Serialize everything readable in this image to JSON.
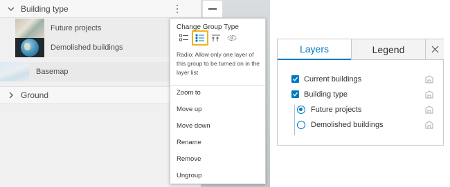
{
  "layer_list": {
    "group": {
      "title": "Building type"
    },
    "children": [
      {
        "label": "Future projects"
      },
      {
        "label": "Demolished buildings"
      }
    ],
    "basemap": {
      "label": "Basemap"
    },
    "ground": {
      "label": "Ground"
    }
  },
  "context_menu": {
    "title": "Change Group Type",
    "type_icons": [
      "checkbox-list-icon",
      "radio-list-icon",
      "exclusive-order-icon",
      "hidden-list-icon"
    ],
    "selected_type": "radio-list-icon",
    "description": "Radio: Allow only one layer of this group to be turned on in the layer list",
    "items": [
      "Zoom to",
      "Move up",
      "Move down",
      "Rename",
      "Remove",
      "Ungroup"
    ],
    "highlight_color": "#f0b41a"
  },
  "layers_widget": {
    "tabs": [
      "Layers",
      "Legend"
    ],
    "active_tab": "Layers",
    "accent": "#0079c1",
    "rows": [
      {
        "label": "Current buildings",
        "control": "checkbox",
        "checked": true
      },
      {
        "label": "Building type",
        "control": "checkbox",
        "checked": true
      },
      {
        "label": "Future projects",
        "control": "radio",
        "checked": true
      },
      {
        "label": "Demolished buildings",
        "control": "radio",
        "checked": false
      }
    ]
  }
}
